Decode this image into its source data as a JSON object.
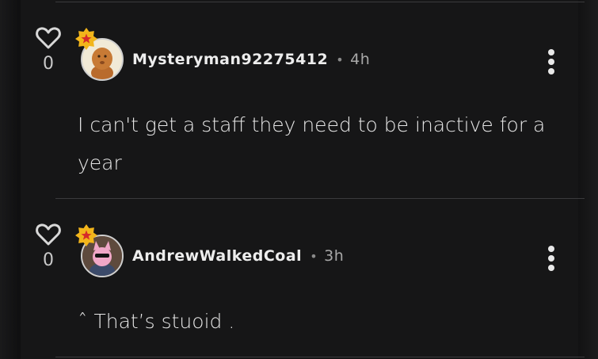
{
  "comments": [
    {
      "like_count": "0",
      "username": "Mysteryman92275412",
      "separator": "•",
      "time": "4h",
      "text": "I can't get a staff they need to be inactive for a year",
      "avatar_color": "#f3ecd8"
    },
    {
      "like_count": "0",
      "username": "AndrewWalkedCoal",
      "separator": "•",
      "time": "3h",
      "text": "ˆ That’s stuoid .",
      "avatar_color": "#6b5546"
    }
  ],
  "colors": {
    "badge": "#f2b51b",
    "badge_star": "#d62a2a",
    "text": "#e6e6e6",
    "panel": "#161617"
  },
  "icons": {
    "like": "heart-outline-icon",
    "menu": "more-vertical-icon",
    "badge": "star-badge-icon"
  }
}
